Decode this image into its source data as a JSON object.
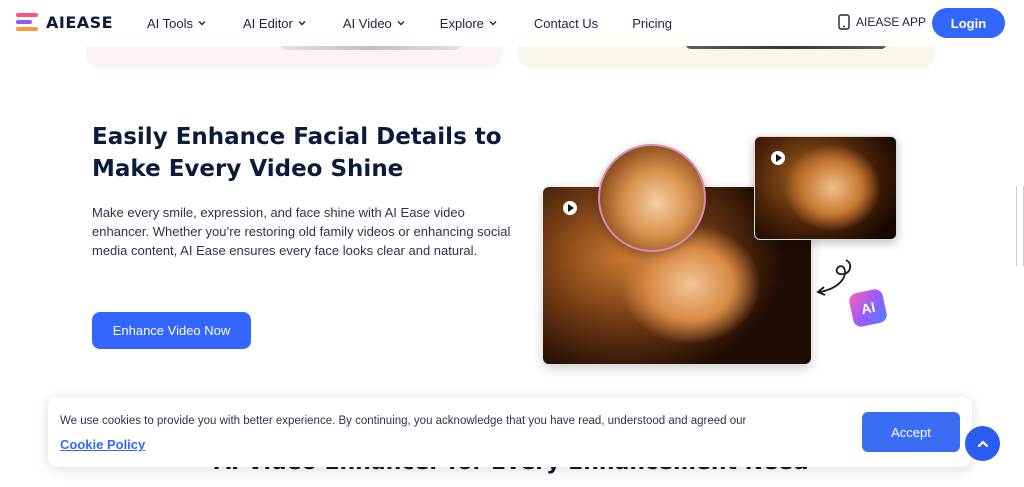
{
  "nav": {
    "logo": "AIEASE",
    "menu": [
      {
        "label": "AI Tools",
        "dropdown": true
      },
      {
        "label": "AI Editor",
        "dropdown": true
      },
      {
        "label": "AI Video",
        "dropdown": true
      },
      {
        "label": "Explore",
        "dropdown": true
      },
      {
        "label": "Contact Us",
        "dropdown": false
      },
      {
        "label": "Pricing",
        "dropdown": false
      }
    ],
    "app_label": "AIEASE APP",
    "login_label": "Login"
  },
  "hero": {
    "title": "Easily Enhance Facial Details to Make Every Video Shine",
    "description": "Make every smile, expression, and face shine with AI Ease video enhancer. Whether you’re restoring old family videos or enhancing social media content, AI Ease ensures every face looks clear and natural.",
    "cta_label": "Enhance Video Now",
    "badge_text": "AI"
  },
  "next_section": {
    "heading": "AI Video Enhancer for Every Enhancement Need"
  },
  "cookie": {
    "message": "We use cookies to provide you with better experience. By continuing, you acknowledge that you have read, understood and agreed our",
    "link_label": "Cookie Policy",
    "accept_label": "Accept"
  },
  "colors": {
    "primary": "#3366ff",
    "text_dark": "#0b1b3a"
  }
}
